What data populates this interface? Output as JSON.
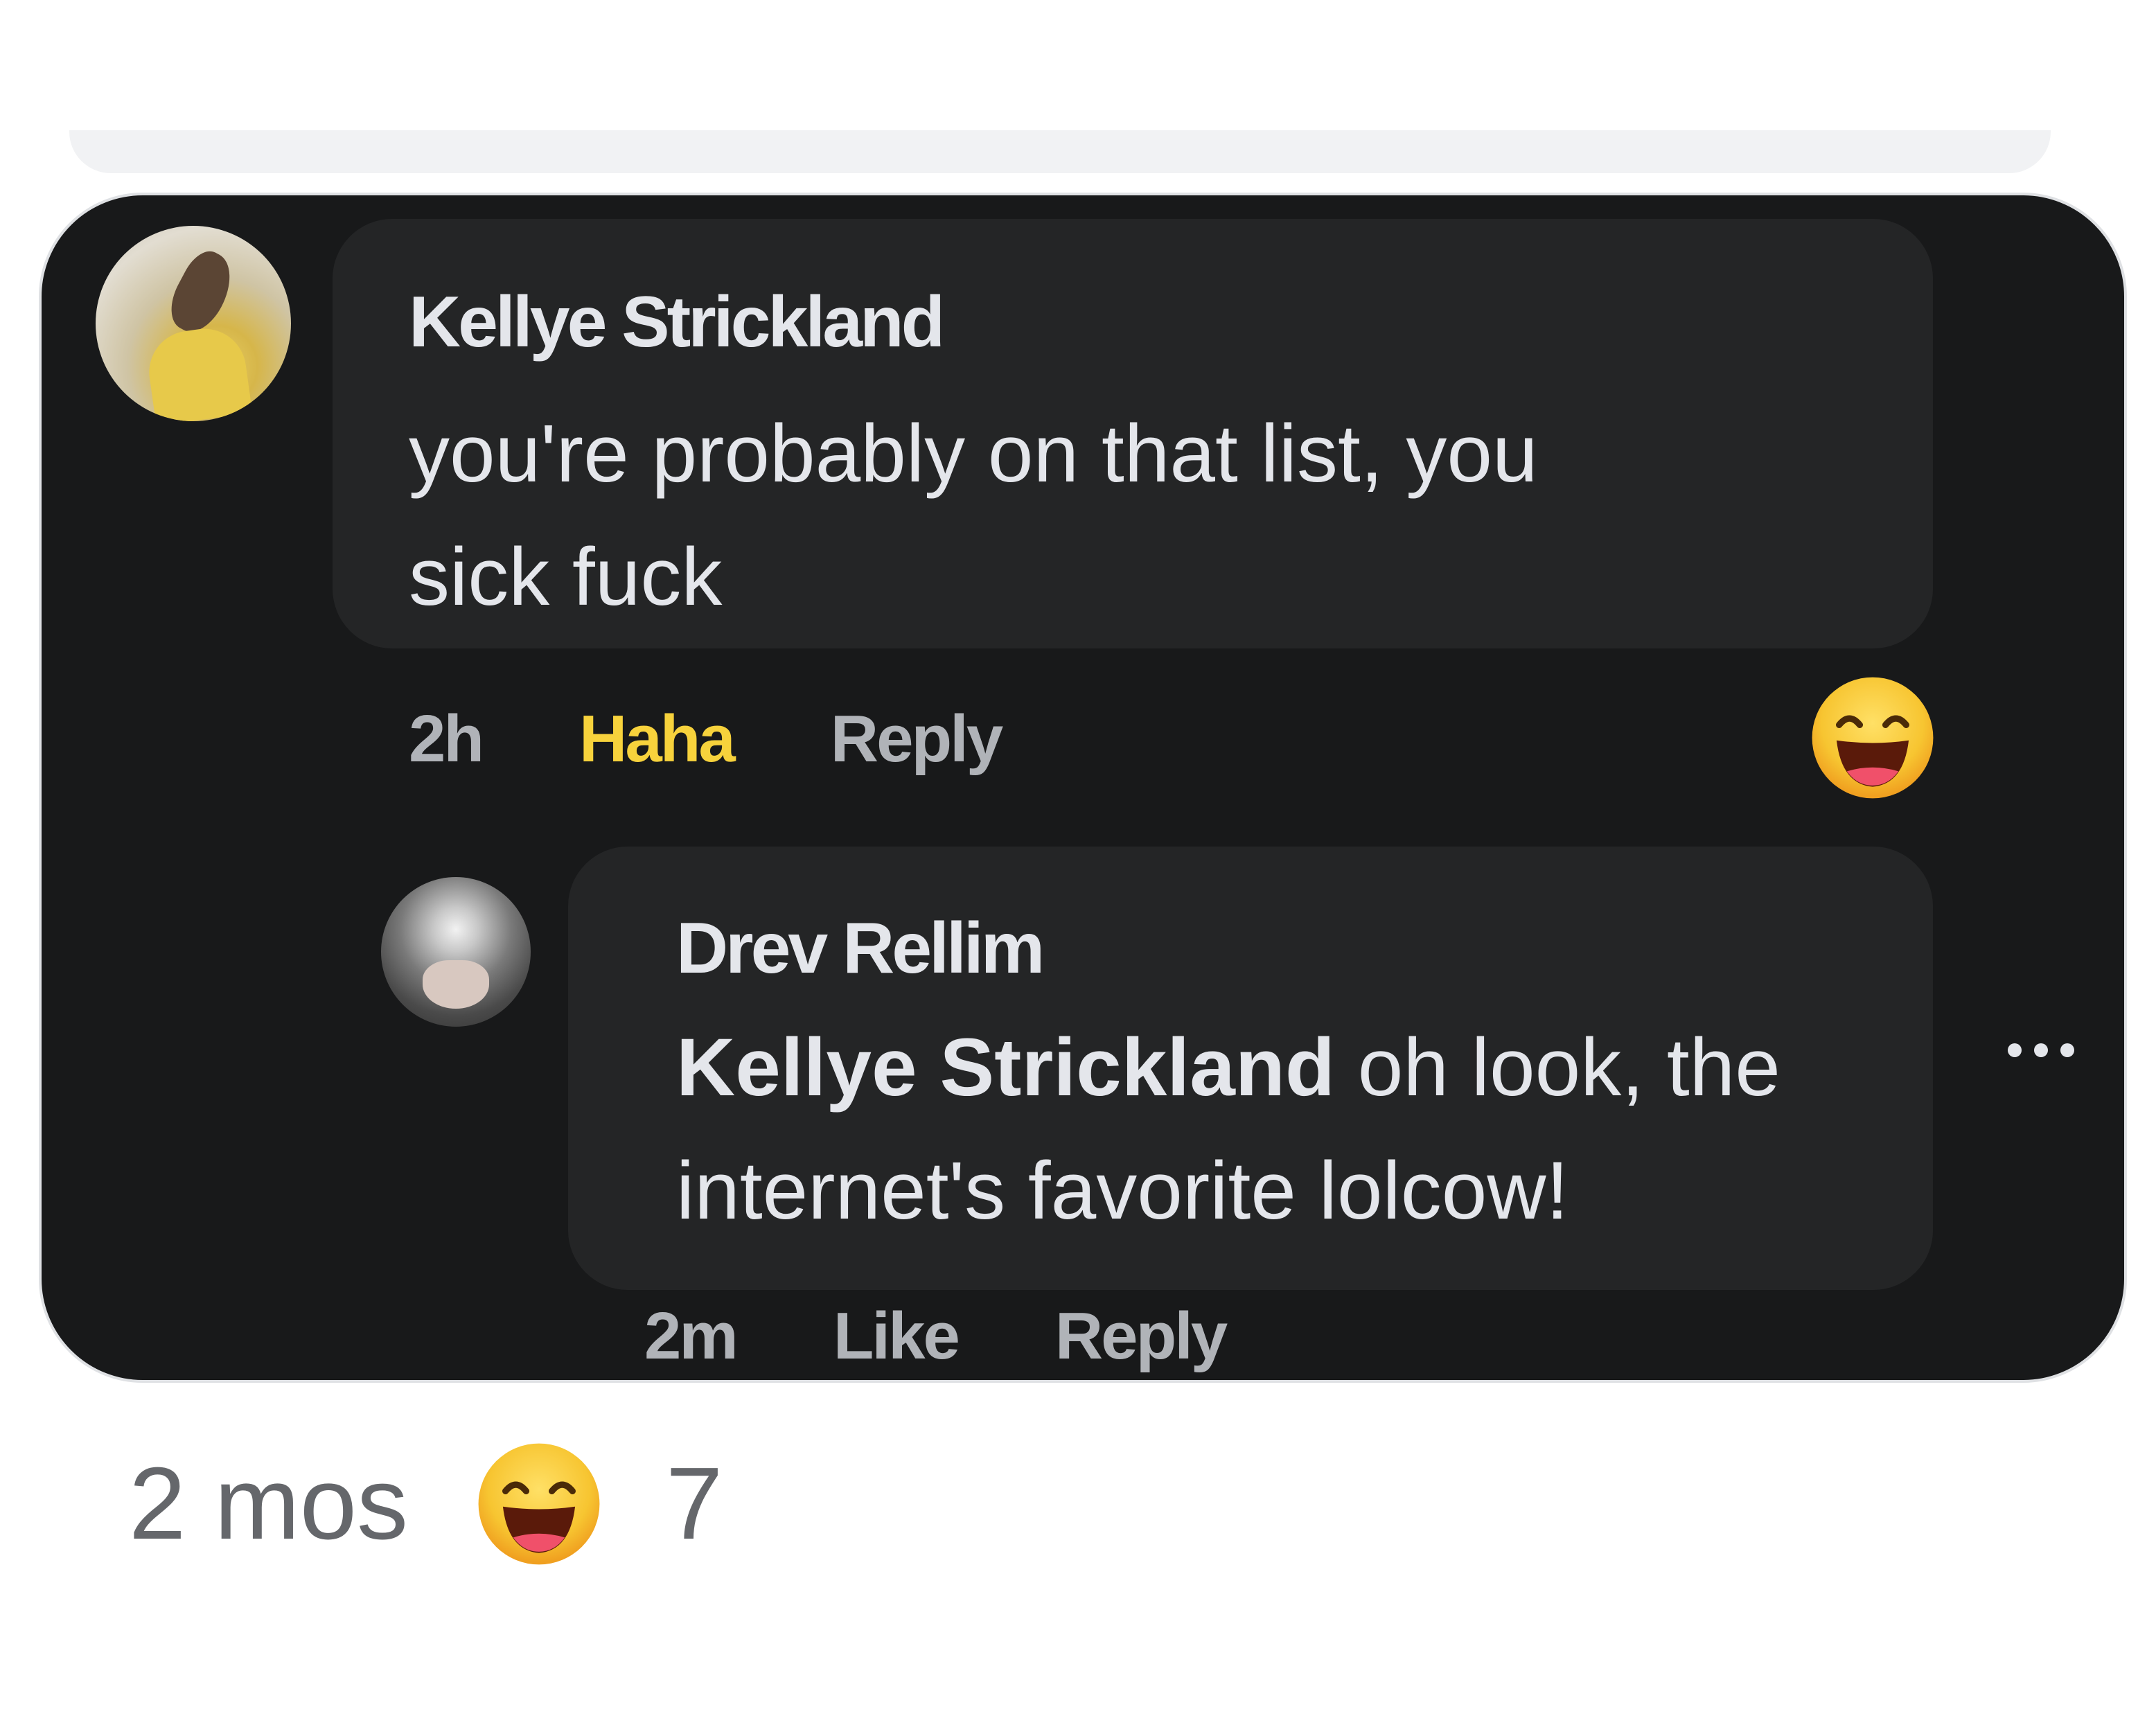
{
  "comment": {
    "author": "Kellye Strickland",
    "text_line1": "you're probably on that list, you",
    "text_line2": "sick fuck",
    "time": "2h",
    "reaction_label": "Haha",
    "reply_label": "Reply",
    "reaction_icon": "laughing-emoji-icon"
  },
  "reply": {
    "author": "Drev Rellim",
    "mention": "Kellye Strickland",
    "text_line1_rest": " oh look, the",
    "text_line2": "internet's favorite lolcow!",
    "time": "2m",
    "like_label": "Like",
    "reply_label": "Reply",
    "more_icon": "more-options-icon"
  },
  "post_footer": {
    "time": "2 mos",
    "reaction_icon": "laughing-emoji-icon",
    "reaction_count": "7"
  },
  "colors": {
    "card_bg": "#18191a",
    "bubble_bg": "#242526",
    "text_primary": "#e4e6eb",
    "text_secondary": "#b0b3b8",
    "haha_yellow": "#f7d23c",
    "footer_gray": "#65676b"
  }
}
